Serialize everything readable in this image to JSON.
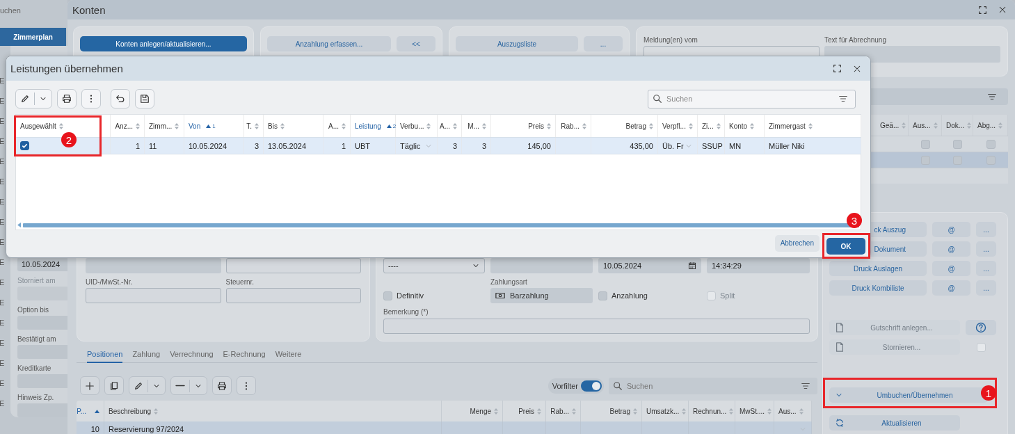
{
  "side_strip": {
    "search_text": "uchen",
    "nav_button": "Zimmerplan",
    "row_marks": [
      "E",
      "E",
      "E",
      "E",
      "E",
      "E",
      "E",
      "E",
      "E",
      "E",
      "E",
      "E",
      "E",
      "E",
      "E",
      "E",
      "E"
    ]
  },
  "side_panel": {
    "fields": [
      {
        "value": "10.05.2024"
      },
      {
        "label": "Storniert am",
        "disabled": true
      },
      {
        "label": "Option bis",
        "disabled": false
      },
      {
        "label": "Bestätigt am",
        "disabled": false
      },
      {
        "label": "Kreditkarte",
        "disabled": false
      },
      {
        "label": "Hinweis Zp.",
        "disabled": false
      }
    ]
  },
  "window": {
    "title": "Konten"
  },
  "action_cards": [
    {
      "buttons": [
        {
          "label": "Konten anlegen/aktualisieren...",
          "primary": true
        }
      ]
    },
    {
      "buttons": [
        {
          "label": "Anzahlung erfassen...",
          "primary": false
        },
        {
          "label": "<<",
          "primary": false
        }
      ]
    },
    {
      "buttons": [
        {
          "label": "Auszugsliste",
          "primary": false
        },
        {
          "label": "...",
          "primary": false
        }
      ]
    }
  ],
  "report_fields": [
    {
      "label": "Meldung(en) vom",
      "kind": "input"
    },
    {
      "label": "Text für Abrechnung",
      "kind": "readonly"
    }
  ],
  "side_table": {
    "columns": [
      "Geä...",
      "Aus...",
      "Dok...",
      "Abg..."
    ],
    "rows": [
      {
        "selected": false,
        "checks": [
          false,
          false,
          false
        ]
      },
      {
        "selected": true,
        "checks": [
          false,
          false,
          false
        ]
      },
      {
        "selected": false
      }
    ]
  },
  "address_form": {
    "fields": [
      {
        "label": "UID-/MwSt.-Nr."
      },
      {
        "label": "Steuernr."
      }
    ]
  },
  "payment_form": {
    "select_value": "----",
    "date": "10.05.2024",
    "time": "14:34:29",
    "payment_label": "Zahlungsart",
    "payment_value": "Barzahlung",
    "checks": [
      {
        "label": "Definitiv",
        "checked": false,
        "disabled": false
      },
      {
        "label": "Anzahlung",
        "checked": false,
        "disabled": false
      },
      {
        "label": "Split",
        "checked": false,
        "disabled": true
      }
    ],
    "remark_label": "Bemerkung (*)"
  },
  "actions": {
    "print_rows": [
      {
        "label": "ck Auszug",
        "mail": "@",
        "more": "..."
      },
      {
        "label": "Dokument",
        "mail": "@",
        "more": "..."
      },
      {
        "label": "Druck Auslagen",
        "mail": "@",
        "more": "..."
      },
      {
        "label": "Druck Kombiliste",
        "mail": "@",
        "more": "..."
      }
    ],
    "credit_button": {
      "label": "Gutschrift anlegen...",
      "disabled": true
    },
    "cancel_button": {
      "label": "Stornieren...",
      "disabled": true
    },
    "cancel_check": {
      "checked": false,
      "disabled": true
    },
    "rebook_button": {
      "label": "Umbuchen/Übernehmen",
      "callout": "1"
    },
    "refresh_button": {
      "label": "Aktualisieren"
    }
  },
  "tabs": [
    {
      "label": "Positionen",
      "selected": true
    },
    {
      "label": "Zahlung",
      "selected": false
    },
    {
      "label": "Verrechnung",
      "selected": false
    },
    {
      "label": "E-Rechnung",
      "selected": false
    },
    {
      "label": "Weitere",
      "selected": false
    }
  ],
  "positions_toolbar": {
    "prefilter": {
      "label": "Vorfilter",
      "on": true
    },
    "search": {
      "placeholder": "Suchen"
    }
  },
  "positions_table": {
    "columns": [
      {
        "label": "P...",
        "kind": "number",
        "sorted": true
      },
      {
        "label": "Beschreibung",
        "kind": "text",
        "sorted": false
      },
      {
        "label": "Menge",
        "kind": "number",
        "sorted": false
      },
      {
        "label": "Preis",
        "kind": "number",
        "sorted": false
      },
      {
        "label": "Rab...",
        "kind": "number",
        "sorted": false
      },
      {
        "label": "Betrag",
        "kind": "number",
        "sorted": false
      },
      {
        "label": "Umsatzk...",
        "kind": "text",
        "sorted": false
      },
      {
        "label": "Rechnun...",
        "kind": "text",
        "sorted": false
      },
      {
        "label": "MwSt....",
        "kind": "text",
        "sorted": false
      },
      {
        "label": "Aus...",
        "kind": "select",
        "sorted": false
      }
    ],
    "rows": [
      {
        "selected": true,
        "cells": [
          "10",
          "Reservierung 97/2024"
        ]
      }
    ]
  },
  "dialog": {
    "title": "Leistungen übernehmen",
    "search": {
      "placeholder": "Suchen"
    },
    "table": {
      "columns": [
        {
          "label": "Ausgewählt",
          "kind": "check",
          "callout": "2"
        },
        {
          "label": "Anz...",
          "kind": "number"
        },
        {
          "label": "Zimm...",
          "kind": "text"
        },
        {
          "label": "Von",
          "kind": "text",
          "sort_index": "1"
        },
        {
          "label": "T.",
          "kind": "number"
        },
        {
          "label": "Bis",
          "kind": "text"
        },
        {
          "label": "A...",
          "kind": "number"
        },
        {
          "label": "Leistung",
          "kind": "text",
          "sort_index": "2"
        },
        {
          "label": "Verbu...",
          "kind": "select"
        },
        {
          "label": "A...",
          "kind": "number"
        },
        {
          "label": "M...",
          "kind": "number"
        },
        {
          "label": "Preis",
          "kind": "number"
        },
        {
          "label": "Rab...",
          "kind": "number"
        },
        {
          "label": "Betrag",
          "kind": "number"
        },
        {
          "label": "Verpfl...",
          "kind": "select"
        },
        {
          "label": "Zi...",
          "kind": "text"
        },
        {
          "label": "Konto",
          "kind": "text"
        },
        {
          "label": "Zimmergast",
          "kind": "text"
        }
      ],
      "rows": [
        {
          "selected": true,
          "checked": true,
          "cells": [
            "",
            "1",
            "11",
            "10.05.2024",
            "3",
            "13.05.2024",
            "1",
            "UBT",
            "Täglic",
            "3",
            "3",
            "145,00",
            "",
            "435,00",
            "Üb. Fr",
            "SSUP",
            "MN",
            "Müller Niki"
          ]
        }
      ]
    },
    "cancel_button": "Abbrechen",
    "ok_button": {
      "label": "OK",
      "callout": "3"
    }
  }
}
